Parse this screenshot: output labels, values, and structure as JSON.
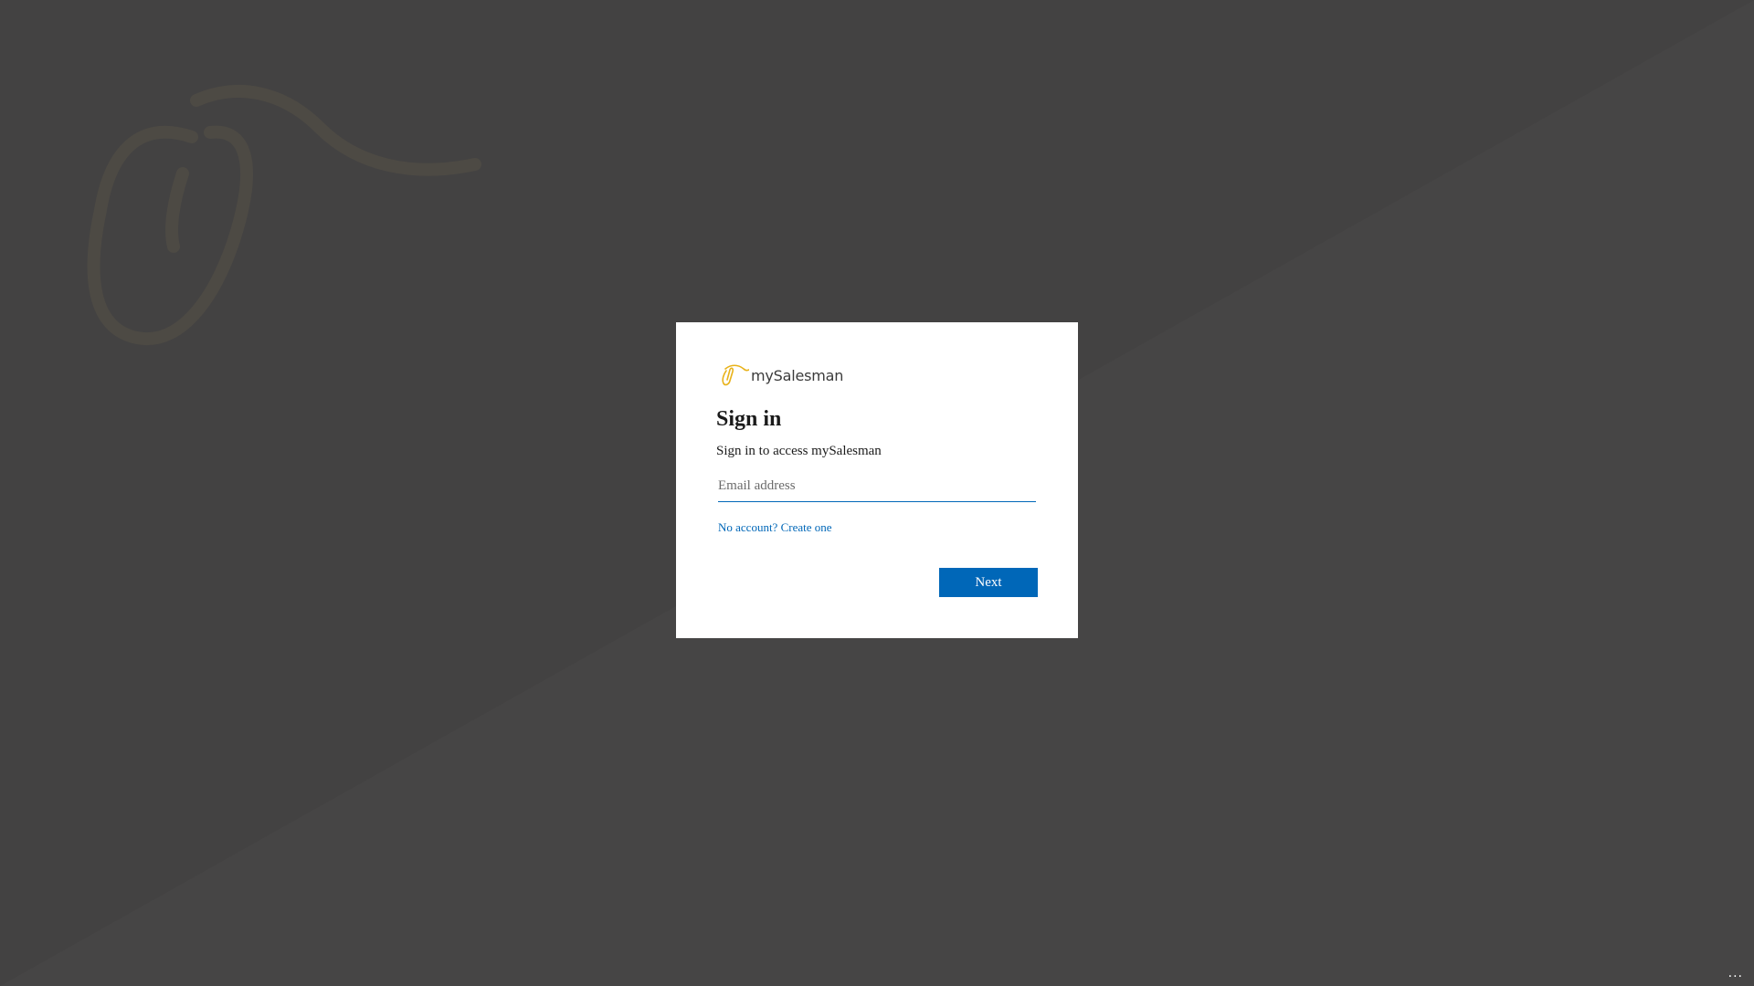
{
  "brand": {
    "name": "mySalesman",
    "accent_color": "#e8b21a"
  },
  "signin": {
    "title": "Sign in",
    "subtitle": "Sign in to access mySalesman",
    "email_placeholder": "Email address",
    "email_value": "",
    "create_account_link": "No account? Create one",
    "next_label": "Next"
  },
  "footer": {
    "more_options": "..."
  },
  "colors": {
    "background": "#434242",
    "card": "#ffffff",
    "primary": "#0067b8"
  }
}
